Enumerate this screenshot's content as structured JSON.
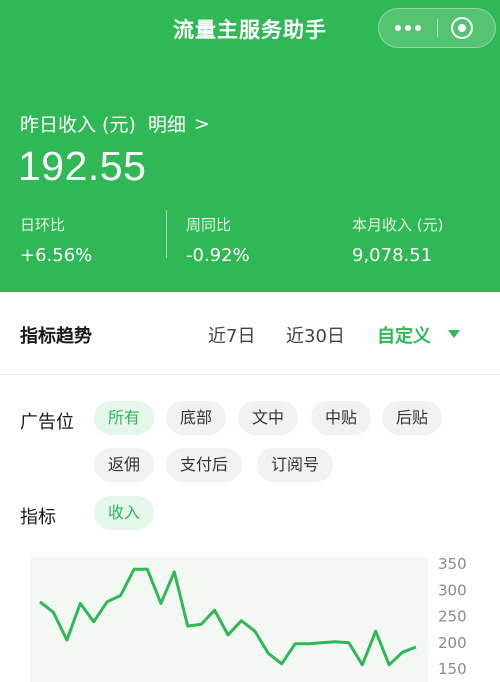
{
  "header": {
    "title": "流量主服务助手",
    "income_title": "昨日收入 (元)",
    "detail_label": "明细",
    "detail_chevron": ">",
    "income_value": "192.55",
    "stats": [
      {
        "label": "日环比",
        "value": "+6.56%"
      },
      {
        "label": "周同比",
        "value": "-0.92%"
      },
      {
        "label": "本月收入 (元)",
        "value": "9,078.51"
      }
    ],
    "accent_color": "#2fb855"
  },
  "trend": {
    "title": "指标趋势",
    "ranges": [
      "近7日",
      "近30日",
      "自定义"
    ],
    "selected_range": "自定义"
  },
  "filters": {
    "ad_position_label": "广告位",
    "ad_positions": [
      "所有",
      "底部",
      "文中",
      "中贴",
      "后贴",
      "返佣",
      "支付后",
      "订阅号"
    ],
    "selected_ad_position": "所有",
    "metric_label": "指标",
    "metrics": [
      "收入"
    ],
    "selected_metric": "收入"
  },
  "chart_data": {
    "type": "line",
    "title": "",
    "xlabel": "",
    "ylabel": "",
    "ylim": [
      140,
      360
    ],
    "y_ticks": [
      350,
      300,
      250,
      200,
      150
    ],
    "grid": false,
    "series": [
      {
        "values": [
          278,
          258,
          205,
          275,
          240,
          278,
          290,
          340,
          340,
          275,
          335,
          232,
          235,
          262,
          215,
          242,
          222,
          180,
          160,
          198,
          198,
          200,
          202,
          200,
          158,
          222,
          158,
          182,
          192
        ]
      }
    ]
  }
}
